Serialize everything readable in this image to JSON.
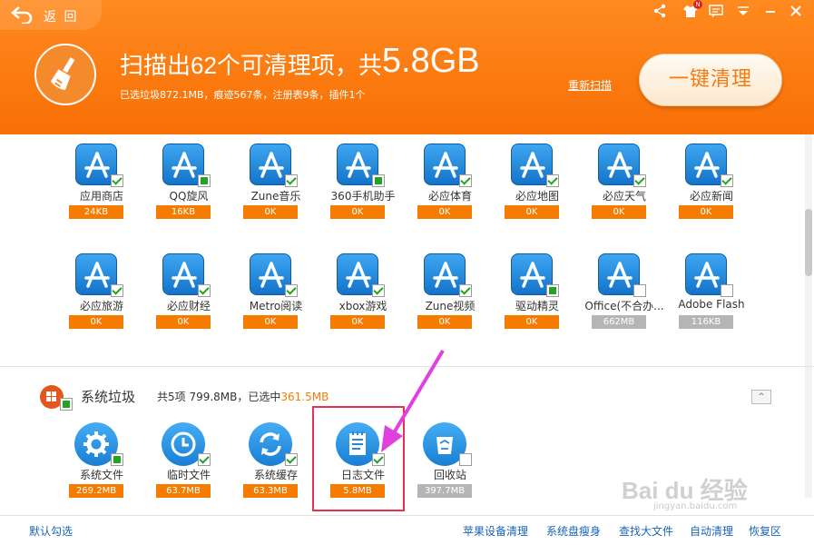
{
  "header": {
    "back_label": "返 回",
    "headline_text": "扫描出62个可清理项，共",
    "headline_size": "5.8GB",
    "subline": "已选垃圾872.1MB，痕迹567条，注册表9条，插件1个",
    "rescan_label": "重新扫描",
    "clean_button_label": "一键清理",
    "badge": "N"
  },
  "apps_row1": [
    {
      "label": "应用商店",
      "size": "24KB",
      "check": "checked",
      "tag": "orange"
    },
    {
      "label": "QQ旋风",
      "size": "16KB",
      "check": "partial",
      "tag": "orange"
    },
    {
      "label": "Zune音乐",
      "size": "0K",
      "check": "checked",
      "tag": "orange"
    },
    {
      "label": "360手机助手",
      "size": "0K",
      "check": "partial",
      "tag": "orange"
    },
    {
      "label": "必应体育",
      "size": "0K",
      "check": "checked",
      "tag": "orange"
    },
    {
      "label": "必应地图",
      "size": "0K",
      "check": "checked",
      "tag": "orange"
    },
    {
      "label": "必应天气",
      "size": "0K",
      "check": "checked",
      "tag": "orange"
    },
    {
      "label": "必应新闻",
      "size": "0K",
      "check": "checked",
      "tag": "orange"
    }
  ],
  "apps_row2": [
    {
      "label": "必应旅游",
      "size": "0K",
      "check": "checked",
      "tag": "orange"
    },
    {
      "label": "必应财经",
      "size": "0K",
      "check": "checked",
      "tag": "orange"
    },
    {
      "label": "Metro阅读",
      "size": "0K",
      "check": "checked",
      "tag": "orange"
    },
    {
      "label": "xbox游戏",
      "size": "0K",
      "check": "checked",
      "tag": "orange"
    },
    {
      "label": "Zune视频",
      "size": "0K",
      "check": "checked",
      "tag": "orange"
    },
    {
      "label": "驱动精灵",
      "size": "0K",
      "check": "partial",
      "tag": "orange"
    },
    {
      "label": "Office(不合办...",
      "size": "662MB",
      "check": "unchecked",
      "tag": "gray"
    },
    {
      "label": "Adobe Flash",
      "size": "116KB",
      "check": "unchecked",
      "tag": "gray"
    }
  ],
  "system": {
    "title": "系统垃圾",
    "summary_prefix": "共5项 799.8MB，已选中",
    "summary_selected": "361.5MB",
    "collapse": "^",
    "items": [
      {
        "label": "系统文件",
        "size": "269.2MB",
        "check": "partial",
        "tag": "orange",
        "icon": "gear-icon"
      },
      {
        "label": "临时文件",
        "size": "63.7MB",
        "check": "checked",
        "tag": "orange",
        "icon": "clock-icon"
      },
      {
        "label": "系统缓存",
        "size": "63.3MB",
        "check": "checked",
        "tag": "orange",
        "icon": "refresh-icon"
      },
      {
        "label": "日志文件",
        "size": "5.8MB",
        "check": "checked",
        "tag": "orange",
        "icon": "notepad-icon"
      },
      {
        "label": "回收站",
        "size": "397.7MB",
        "check": "unchecked",
        "tag": "gray",
        "icon": "recycle-bin-icon"
      }
    ]
  },
  "watermark": {
    "logo": "Bai du 经验",
    "url": "jingyan.baidu.com"
  },
  "footer": {
    "default_check": "默认勾选",
    "links": [
      "苹果设备清理",
      "系统盘瘦身",
      "查找大文件",
      "自动清理",
      "恢复区"
    ]
  },
  "colors": {
    "accent": "#f57c00",
    "header": "#f7780a",
    "link": "#1a63b8",
    "highlight": "#e83050",
    "arrow": "#e040e0"
  }
}
